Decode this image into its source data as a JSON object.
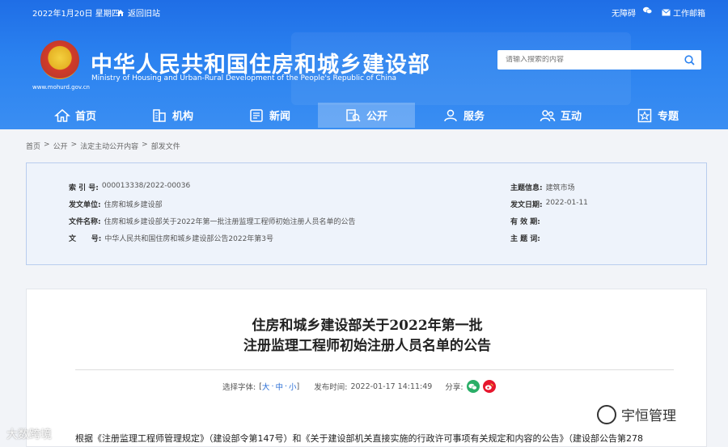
{
  "topbar": {
    "date": "2022年1月20日 星期四",
    "home_link": "返回旧站",
    "accessibility": "无障碍",
    "mail_link": "工作邮箱"
  },
  "header": {
    "domain": "www.mohurd.gov.cn",
    "title": "中华人民共和国住房和城乡建设部",
    "subtitle": "Ministry of Housing and Urban-Rural Development of the People's Republic of China",
    "search_placeholder": "请输入搜索的内容"
  },
  "nav": {
    "items": [
      {
        "label": "首页",
        "icon": "home-icon"
      },
      {
        "label": "机构",
        "icon": "building-icon"
      },
      {
        "label": "新闻",
        "icon": "news-icon"
      },
      {
        "label": "公开",
        "icon": "disclosure-icon"
      },
      {
        "label": "服务",
        "icon": "service-icon"
      },
      {
        "label": "互动",
        "icon": "interaction-icon"
      },
      {
        "label": "专题",
        "icon": "topic-icon"
      }
    ],
    "active": "公开"
  },
  "breadcrumb": [
    "首页",
    ">",
    "公开",
    ">",
    "法定主动公开内容",
    ">",
    "部发文件"
  ],
  "meta": {
    "index_label": "索 引 号:",
    "index_value": "000013338/2022-00036",
    "issuer_label": "发文单位:",
    "issuer_value": "住房和城乡建设部",
    "docname_label": "文件名称:",
    "docname_value": "住房和城乡建设部关于2022年第一批注册监理工程师初始注册人员名单的公告",
    "docnum_label": "文      号:",
    "docnum_value": "中华人民共和国住房和城乡建设部公告2022年第3号",
    "topic_label": "主题信息:",
    "topic_value": "建筑市场",
    "date_label": "发文日期:",
    "date_value": "2022-01-11",
    "validity_label": "有 效 期:",
    "validity_value": "",
    "keywords_label": "主 题 词:",
    "keywords_value": ""
  },
  "doc": {
    "title_line1": "住房和城乡建设部关于2022年第一批",
    "title_line2": "注册监理工程师初始注册人员名单的公告",
    "font_label": "选择字体:",
    "font_open": "[",
    "font_large": "大",
    "font_sep1": "·",
    "font_medium": "中",
    "font_sep2": "·",
    "font_small": "小",
    "font_close": "]",
    "publish_label": "发布时间:",
    "publish_value": "2022-01-17 14:11:49",
    "share_label": "分享:",
    "body": "根据《注册监理工程师管理规定》（建设部令第147号）和《关于建设部机关直接实施的行政许可事项有关规定和内容的公告》（建设部公告第278"
  },
  "watermarks": {
    "left": "大数跨境",
    "right": "宇恒管理"
  },
  "colors": {
    "header_blue": "#2b82f0",
    "meta_bg": "#eef3fb",
    "wechat_green": "#2aae67",
    "weibo_red": "#e6162d"
  }
}
